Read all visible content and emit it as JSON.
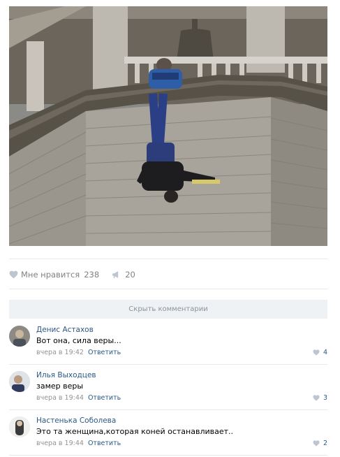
{
  "post": {
    "photo": {
      "icon": "photo-tower-scene"
    },
    "actions": {
      "like_label": "Мне нравится",
      "like_count": "238",
      "repost_count": "20",
      "like_icon": "heart-icon",
      "repost_icon": "megaphone-icon"
    }
  },
  "comments_section": {
    "hide_label": "Скрыть комментарии",
    "items": [
      {
        "author": "Денис Астахов",
        "text": "Вот она, сила веры...",
        "time": "вчера в 19:42",
        "reply": "Ответить",
        "likes": "4"
      },
      {
        "author": "Илья Выходцев",
        "text": "замер веры",
        "time": "вчера в 19:44",
        "reply": "Ответить",
        "likes": "3"
      },
      {
        "author": "Настенька Соболева",
        "text": "Это та женщина,которая коней останавливает..",
        "time": "вчера в 19:44",
        "reply": "Ответить",
        "likes": "2"
      }
    ]
  },
  "colors": {
    "link": "#2a5885",
    "muted": "#939393",
    "divider": "#e7e8ec",
    "bar": "#eff2f5"
  }
}
